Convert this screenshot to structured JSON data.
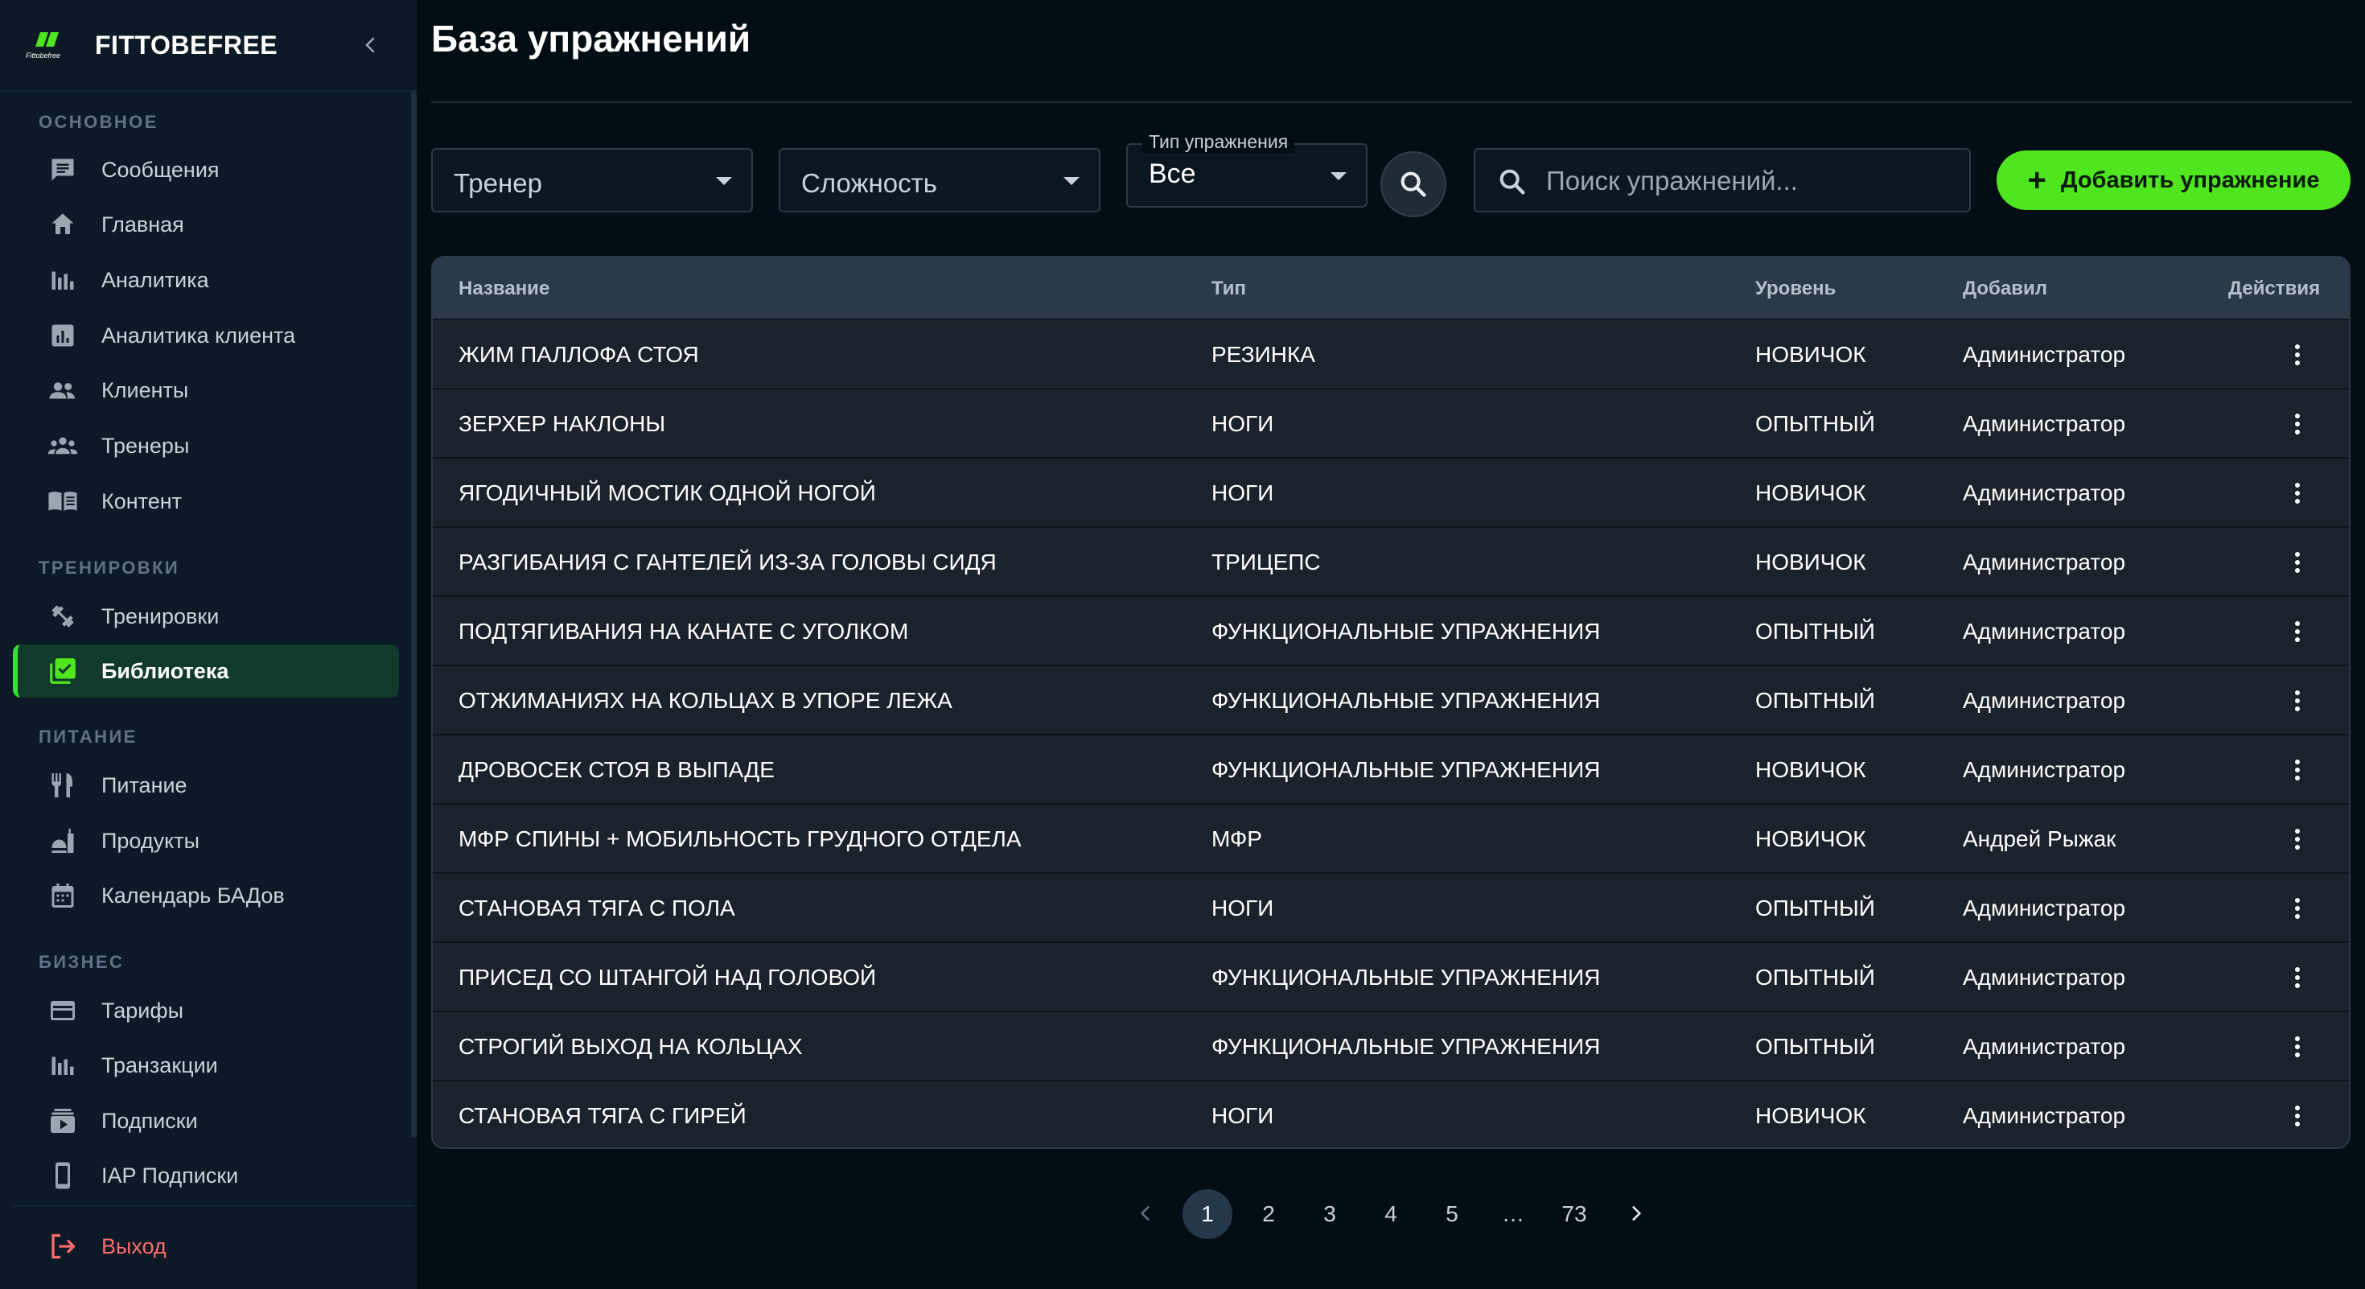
{
  "sidebar": {
    "brand": "FITTOBEFREE",
    "logo_text": "Fittobefree",
    "sections": [
      {
        "title": "ОСНОВНОЕ",
        "items": [
          {
            "label": "Сообщения",
            "icon": "message-icon"
          },
          {
            "label": "Главная",
            "icon": "home-icon"
          },
          {
            "label": "Аналитика",
            "icon": "analytics-icon"
          },
          {
            "label": "Аналитика клиента",
            "icon": "client-analytics-icon"
          },
          {
            "label": "Клиенты",
            "icon": "clients-icon"
          },
          {
            "label": "Тренеры",
            "icon": "trainers-icon"
          },
          {
            "label": "Контент",
            "icon": "content-icon"
          }
        ]
      },
      {
        "title": "ТРЕНИРОВКИ",
        "items": [
          {
            "label": "Тренировки",
            "icon": "workout-icon"
          },
          {
            "label": "Библиотека",
            "icon": "library-icon",
            "active": true
          }
        ]
      },
      {
        "title": "ПИТАНИЕ",
        "items": [
          {
            "label": "Питание",
            "icon": "nutrition-icon"
          },
          {
            "label": "Продукты",
            "icon": "products-icon"
          },
          {
            "label": "Календарь БАДов",
            "icon": "calendar-icon"
          }
        ]
      },
      {
        "title": "БИЗНЕС",
        "items": [
          {
            "label": "Тарифы",
            "icon": "credit-card-icon"
          },
          {
            "label": "Транзакции",
            "icon": "transactions-icon"
          },
          {
            "label": "Подписки",
            "icon": "subscriptions-icon"
          },
          {
            "label": "IAP Подписки",
            "icon": "phone-icon"
          }
        ]
      }
    ],
    "logout_label": "Выход"
  },
  "page": {
    "title": "База упражнений"
  },
  "filters": {
    "trainer_placeholder": "Тренер",
    "difficulty_placeholder": "Сложность",
    "type_label": "Тип упражнения",
    "type_value": "Все",
    "search_placeholder": "Поиск упражнений...",
    "add_label": "Добавить упражнение",
    "add_symbol": "+"
  },
  "table": {
    "columns": [
      "Название",
      "Тип",
      "Уровень",
      "Добавил",
      "Действия"
    ],
    "rows": [
      [
        "ЖИМ ПАЛЛОФА СТОЯ",
        "РЕЗИНКА",
        "НОВИЧОК",
        "Администратор"
      ],
      [
        "ЗЕРХЕР НАКЛОНЫ",
        "НОГИ",
        "ОПЫТНЫЙ",
        "Администратор"
      ],
      [
        "ЯГОДИЧНЫЙ МОСТИК ОДНОЙ НОГОЙ",
        "НОГИ",
        "НОВИЧОК",
        "Администратор"
      ],
      [
        "РАЗГИБАНИЯ С ГАНТЕЛЕЙ ИЗ-ЗА ГОЛОВЫ СИДЯ",
        "ТРИЦЕПС",
        "НОВИЧОК",
        "Администратор"
      ],
      [
        "ПОДТЯГИВАНИЯ НА КАНАТЕ С УГОЛКОМ",
        "ФУНКЦИОНАЛЬНЫЕ УПРАЖНЕНИЯ",
        "ОПЫТНЫЙ",
        "Администратор"
      ],
      [
        "ОТЖИМАНИЯХ НА КОЛЬЦАХ В УПОРЕ ЛЕЖА",
        "ФУНКЦИОНАЛЬНЫЕ УПРАЖНЕНИЯ",
        "ОПЫТНЫЙ",
        "Администратор"
      ],
      [
        "ДРОВОСЕК СТОЯ В ВЫПАДЕ",
        "ФУНКЦИОНАЛЬНЫЕ УПРАЖНЕНИЯ",
        "НОВИЧОК",
        "Администратор"
      ],
      [
        "МФР СПИНЫ + МОБИЛЬНОСТЬ ГРУДНОГО ОТДЕЛА",
        "МФР",
        "НОВИЧОК",
        "Андрей Рыжак"
      ],
      [
        "СТАНОВАЯ ТЯГА С ПОЛА",
        "НОГИ",
        "ОПЫТНЫЙ",
        "Администратор"
      ],
      [
        "ПРИСЕД СО ШТАНГОЙ НАД ГОЛОВОЙ",
        "ФУНКЦИОНАЛЬНЫЕ УПРАЖНЕНИЯ",
        "ОПЫТНЫЙ",
        "Администратор"
      ],
      [
        "СТРОГИЙ ВЫХОД НА КОЛЬЦАХ",
        "ФУНКЦИОНАЛЬНЫЕ УПРАЖНЕНИЯ",
        "ОПЫТНЫЙ",
        "Администратор"
      ],
      [
        "СТАНОВАЯ ТЯГА С ГИРЕЙ",
        "НОГИ",
        "НОВИЧОК",
        "Администратор"
      ]
    ]
  },
  "pagination": {
    "pages": [
      "1",
      "2",
      "3",
      "4",
      "5",
      "…",
      "73"
    ],
    "current": "1"
  },
  "colors": {
    "accent": "#4fe61f",
    "active_nav_bg": "#0f3a2c",
    "logout": "#ff6b6b",
    "background": "#020d14"
  }
}
